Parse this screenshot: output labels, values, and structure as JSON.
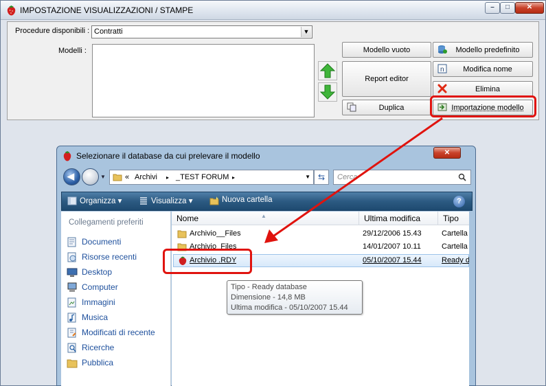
{
  "main_window": {
    "title": "IMPOSTAZIONE VISUALIZZAZIONI / STAMPE",
    "title_buttons": {
      "minimize": "–",
      "maximize": "□",
      "close": "✕"
    },
    "procedure_label": "Procedure disponibili :",
    "procedure_value": "Contratti",
    "models_label": "Modelli :",
    "buttons": {
      "modello_vuoto": "Modello vuoto",
      "modello_predefinito": "Modello predefinito",
      "report_editor": "Report editor",
      "modifica_nome": "Modifica nome",
      "elimina": "Elimina",
      "duplica": "Duplica",
      "importazione_modello": "Importazione modello"
    }
  },
  "dialog": {
    "title": "Selezionare il database da cui prelevare il modello",
    "close": "✕",
    "address": {
      "prefix": "«",
      "segments": [
        "Archivi",
        "_TEST FORUM"
      ],
      "separator": "▸"
    },
    "search_placeholder": "Cerca",
    "toolbar": {
      "organize": "Organizza",
      "view": "Visualizza",
      "new_folder": "Nuova cartella",
      "help": "?"
    },
    "left_pane": {
      "header": "Collegamenti preferiti",
      "items": [
        "Documenti",
        "Risorse recenti",
        "Desktop",
        "Computer",
        "Immagini",
        "Musica",
        "Modificati di recente",
        "Ricerche",
        "Pubblica"
      ]
    },
    "columns": [
      "Nome",
      "Ultima modifica",
      "Tipo"
    ],
    "files": [
      {
        "name": "Archivio__Files",
        "modified": "29/12/2006 15.43",
        "type": "Cartella"
      },
      {
        "name": "Archivio_Files",
        "modified": "14/01/2007 10.11",
        "type": "Cartella"
      },
      {
        "name": "Archivio .RDY",
        "modified": "05/10/2007 15.44",
        "type": "Ready d"
      }
    ],
    "tooltip": [
      "Tipo - Ready database",
      "Dimensione - 14,8 MB",
      "Ultima modifica - 05/10/2007 15.44"
    ]
  },
  "colors": {
    "highlight": "#e0130e",
    "toolbar": "#2c5a82",
    "link": "#1d4f9c"
  }
}
